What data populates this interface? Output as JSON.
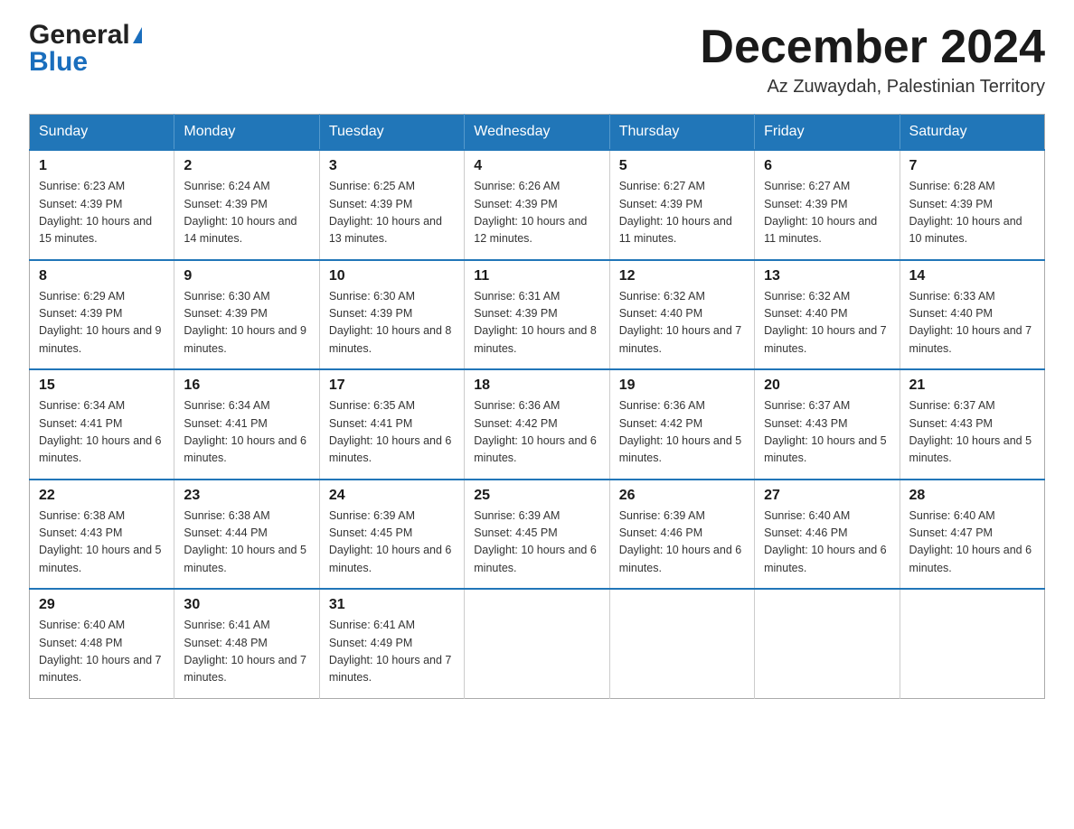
{
  "header": {
    "logo_general": "General",
    "logo_blue": "Blue",
    "month_title": "December 2024",
    "location": "Az Zuwaydah, Palestinian Territory"
  },
  "days_of_week": [
    "Sunday",
    "Monday",
    "Tuesday",
    "Wednesday",
    "Thursday",
    "Friday",
    "Saturday"
  ],
  "weeks": [
    [
      {
        "day": "1",
        "sunrise": "6:23 AM",
        "sunset": "4:39 PM",
        "daylight": "10 hours and 15 minutes."
      },
      {
        "day": "2",
        "sunrise": "6:24 AM",
        "sunset": "4:39 PM",
        "daylight": "10 hours and 14 minutes."
      },
      {
        "day": "3",
        "sunrise": "6:25 AM",
        "sunset": "4:39 PM",
        "daylight": "10 hours and 13 minutes."
      },
      {
        "day": "4",
        "sunrise": "6:26 AM",
        "sunset": "4:39 PM",
        "daylight": "10 hours and 12 minutes."
      },
      {
        "day": "5",
        "sunrise": "6:27 AM",
        "sunset": "4:39 PM",
        "daylight": "10 hours and 11 minutes."
      },
      {
        "day": "6",
        "sunrise": "6:27 AM",
        "sunset": "4:39 PM",
        "daylight": "10 hours and 11 minutes."
      },
      {
        "day": "7",
        "sunrise": "6:28 AM",
        "sunset": "4:39 PM",
        "daylight": "10 hours and 10 minutes."
      }
    ],
    [
      {
        "day": "8",
        "sunrise": "6:29 AM",
        "sunset": "4:39 PM",
        "daylight": "10 hours and 9 minutes."
      },
      {
        "day": "9",
        "sunrise": "6:30 AM",
        "sunset": "4:39 PM",
        "daylight": "10 hours and 9 minutes."
      },
      {
        "day": "10",
        "sunrise": "6:30 AM",
        "sunset": "4:39 PM",
        "daylight": "10 hours and 8 minutes."
      },
      {
        "day": "11",
        "sunrise": "6:31 AM",
        "sunset": "4:39 PM",
        "daylight": "10 hours and 8 minutes."
      },
      {
        "day": "12",
        "sunrise": "6:32 AM",
        "sunset": "4:40 PM",
        "daylight": "10 hours and 7 minutes."
      },
      {
        "day": "13",
        "sunrise": "6:32 AM",
        "sunset": "4:40 PM",
        "daylight": "10 hours and 7 minutes."
      },
      {
        "day": "14",
        "sunrise": "6:33 AM",
        "sunset": "4:40 PM",
        "daylight": "10 hours and 7 minutes."
      }
    ],
    [
      {
        "day": "15",
        "sunrise": "6:34 AM",
        "sunset": "4:41 PM",
        "daylight": "10 hours and 6 minutes."
      },
      {
        "day": "16",
        "sunrise": "6:34 AM",
        "sunset": "4:41 PM",
        "daylight": "10 hours and 6 minutes."
      },
      {
        "day": "17",
        "sunrise": "6:35 AM",
        "sunset": "4:41 PM",
        "daylight": "10 hours and 6 minutes."
      },
      {
        "day": "18",
        "sunrise": "6:36 AM",
        "sunset": "4:42 PM",
        "daylight": "10 hours and 6 minutes."
      },
      {
        "day": "19",
        "sunrise": "6:36 AM",
        "sunset": "4:42 PM",
        "daylight": "10 hours and 5 minutes."
      },
      {
        "day": "20",
        "sunrise": "6:37 AM",
        "sunset": "4:43 PM",
        "daylight": "10 hours and 5 minutes."
      },
      {
        "day": "21",
        "sunrise": "6:37 AM",
        "sunset": "4:43 PM",
        "daylight": "10 hours and 5 minutes."
      }
    ],
    [
      {
        "day": "22",
        "sunrise": "6:38 AM",
        "sunset": "4:43 PM",
        "daylight": "10 hours and 5 minutes."
      },
      {
        "day": "23",
        "sunrise": "6:38 AM",
        "sunset": "4:44 PM",
        "daylight": "10 hours and 5 minutes."
      },
      {
        "day": "24",
        "sunrise": "6:39 AM",
        "sunset": "4:45 PM",
        "daylight": "10 hours and 6 minutes."
      },
      {
        "day": "25",
        "sunrise": "6:39 AM",
        "sunset": "4:45 PM",
        "daylight": "10 hours and 6 minutes."
      },
      {
        "day": "26",
        "sunrise": "6:39 AM",
        "sunset": "4:46 PM",
        "daylight": "10 hours and 6 minutes."
      },
      {
        "day": "27",
        "sunrise": "6:40 AM",
        "sunset": "4:46 PM",
        "daylight": "10 hours and 6 minutes."
      },
      {
        "day": "28",
        "sunrise": "6:40 AM",
        "sunset": "4:47 PM",
        "daylight": "10 hours and 6 minutes."
      }
    ],
    [
      {
        "day": "29",
        "sunrise": "6:40 AM",
        "sunset": "4:48 PM",
        "daylight": "10 hours and 7 minutes."
      },
      {
        "day": "30",
        "sunrise": "6:41 AM",
        "sunset": "4:48 PM",
        "daylight": "10 hours and 7 minutes."
      },
      {
        "day": "31",
        "sunrise": "6:41 AM",
        "sunset": "4:49 PM",
        "daylight": "10 hours and 7 minutes."
      },
      null,
      null,
      null,
      null
    ]
  ],
  "labels": {
    "sunrise_prefix": "Sunrise: ",
    "sunset_prefix": "Sunset: ",
    "daylight_prefix": "Daylight: "
  }
}
